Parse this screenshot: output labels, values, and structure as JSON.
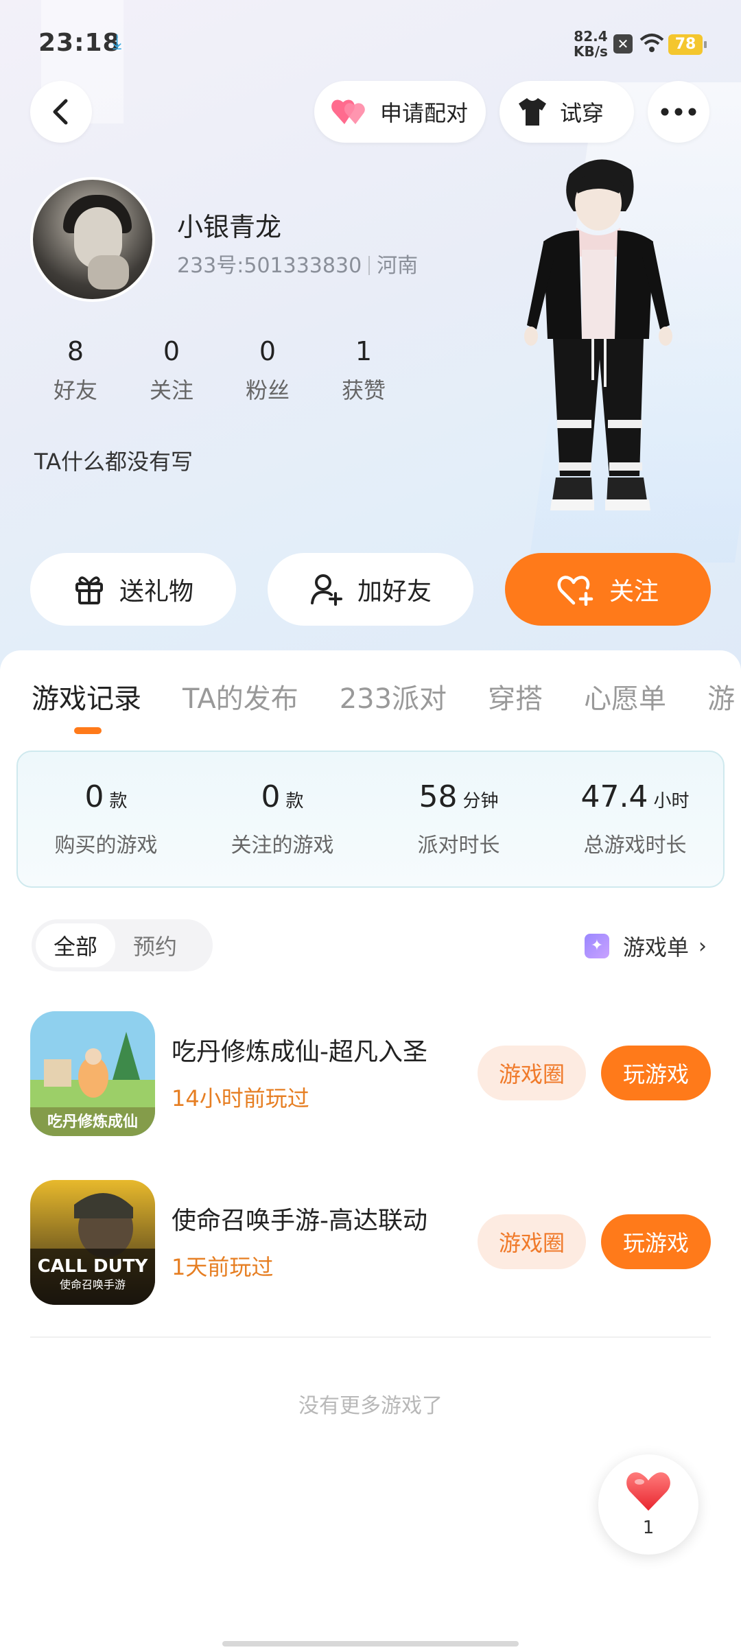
{
  "status_bar": {
    "time": "23:18",
    "net_speed_value": "82.4",
    "net_speed_unit": "KB/s",
    "battery": "78"
  },
  "top_bar": {
    "match_label": "申请配对",
    "tryon_label": "试穿"
  },
  "profile": {
    "name": "小银青龙",
    "id_text": "233号:501333830",
    "region": "河南",
    "stats": [
      {
        "value": "8",
        "label": "好友"
      },
      {
        "value": "0",
        "label": "关注"
      },
      {
        "value": "0",
        "label": "粉丝"
      },
      {
        "value": "1",
        "label": "获赞"
      }
    ],
    "bio": "TA什么都没有写"
  },
  "actions": {
    "gift": "送礼物",
    "add_friend": "加好友",
    "follow": "关注"
  },
  "tabs": [
    "游戏记录",
    "TA的发布",
    "233派对",
    "穿搭",
    "心愿单",
    "游"
  ],
  "summary": [
    {
      "value": "0",
      "unit": "款",
      "label": "购买的游戏"
    },
    {
      "value": "0",
      "unit": "款",
      "label": "关注的游戏"
    },
    {
      "value": "58",
      "unit": "分钟",
      "label": "派对时长"
    },
    {
      "value": "47.4",
      "unit": "小时",
      "label": "总游戏时长"
    }
  ],
  "filter": {
    "all": "全部",
    "reserve": "预约",
    "gamelist": "游戏单"
  },
  "games": [
    {
      "title": "吃丹修炼成仙-超凡入圣",
      "played": "14小时前玩过",
      "circle_label": "游戏圈",
      "play_label": "玩游戏",
      "icon_caption": "吃丹修炼成仙"
    },
    {
      "title": "使命召唤手游-高达联动",
      "played": "1天前玩过",
      "circle_label": "游戏圈",
      "play_label": "玩游戏",
      "icon_caption": "CALL DUTY",
      "icon_subcaption": "使命召唤手游"
    }
  ],
  "empty_text": "没有更多游戏了",
  "like": {
    "count": "1"
  },
  "colors": {
    "accent": "#ff7a1a",
    "played_text": "#e67e22",
    "summary_border": "#cfe9ee"
  }
}
